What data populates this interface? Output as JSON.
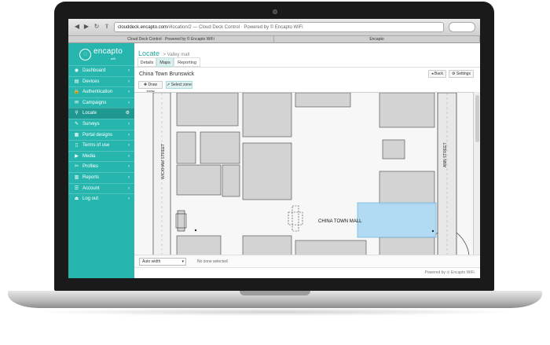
{
  "browser": {
    "url_host": "clouddeck.encapto.com",
    "url_path": "/#location/2 — Cloud Deck Control · Powered by © Encapto WiFi",
    "tabs": [
      "Cloud Deck Control · Powered by © Encapto WiFi",
      "Encapto"
    ]
  },
  "sidebar": {
    "logo_text": "encapto",
    "logo_sub": "wifi",
    "items": [
      {
        "label": "Dashboard",
        "icon": "dashboard-icon",
        "glyph": "◉"
      },
      {
        "label": "Devices",
        "icon": "devices-icon",
        "glyph": "▤"
      },
      {
        "label": "Authentication",
        "icon": "lock-icon",
        "glyph": "🔒"
      },
      {
        "label": "Campaigns",
        "icon": "megaphone-icon",
        "glyph": "✉"
      },
      {
        "label": "Locate",
        "icon": "map-pin-icon",
        "glyph": "⚲",
        "active": true
      },
      {
        "label": "Surveys",
        "icon": "survey-icon",
        "glyph": "✎"
      },
      {
        "label": "Portal designs",
        "icon": "design-icon",
        "glyph": "▦"
      },
      {
        "label": "Terms of use",
        "icon": "document-icon",
        "glyph": "▯"
      },
      {
        "label": "Media",
        "icon": "media-icon",
        "glyph": "▶"
      },
      {
        "label": "Profiles",
        "icon": "wrench-icon",
        "glyph": "✄"
      },
      {
        "label": "Reports",
        "icon": "reports-icon",
        "glyph": "▥"
      },
      {
        "label": "Account",
        "icon": "account-icon",
        "glyph": "☰"
      },
      {
        "label": "Log out",
        "icon": "logout-icon",
        "glyph": "⏏"
      }
    ]
  },
  "header": {
    "title": "Locate",
    "subtitle": "> Valley mall"
  },
  "tabs": [
    "Details",
    "Maps",
    "Reporting"
  ],
  "active_tab": "Maps",
  "location_name": "China Town Brunswick",
  "buttons": {
    "back": "◂ Back",
    "settings": "⚙ Settings",
    "draw_zone": "✚ Draw zone",
    "select_zone": "➚ Select zone"
  },
  "map": {
    "street_left": "WICKHAM STREET",
    "street_right": "ANN STREET",
    "landmark": "CHINA TOWN MALL",
    "selection_color": "#a9d8f3"
  },
  "bottom": {
    "width_select": "Auto width",
    "zone_status": "No zone selected"
  },
  "footer": {
    "powered": "Powered by ⊙ Encapto WiFi."
  },
  "colors": {
    "accent": "#26b6ae",
    "accent_dark": "#1f9891"
  }
}
